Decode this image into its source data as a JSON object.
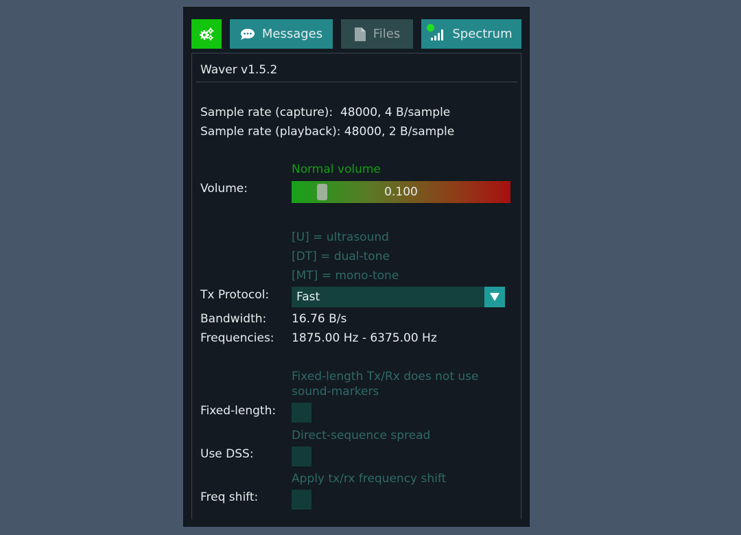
{
  "tabs": {
    "settings": {
      "icon": "gears-icon",
      "active_color": "#13c40f"
    },
    "messages": {
      "label": "Messages",
      "icon": "chat-bubble-icon"
    },
    "files": {
      "label": "Files",
      "icon": "file-icon"
    },
    "spectrum": {
      "label": "Spectrum",
      "icon": "signal-bars-icon"
    }
  },
  "panel": {
    "version": "Waver v1.5.2",
    "capture_rate": "Sample rate (capture):  48000, 4 B/sample",
    "playback_rate": "Sample rate (playback): 48000, 2 B/sample",
    "volume": {
      "status": "Normal volume",
      "label": "Volume:",
      "value": "0.100",
      "fraction": 0.1
    },
    "protocol_hints": [
      "[U] = ultrasound",
      "[DT] = dual-tone",
      "[MT] = mono-tone"
    ],
    "tx_protocol": {
      "label": "Tx Protocol:",
      "selected": "Fast"
    },
    "bandwidth": {
      "label": "Bandwidth:",
      "value": "16.76 B/s"
    },
    "frequencies": {
      "label": "Frequencies:",
      "value": "1875.00 Hz - 6375.00 Hz"
    },
    "fixed_length": {
      "hint_line1": "Fixed-length Tx/Rx does not use",
      "hint_line2": "sound-markers",
      "label": "Fixed-length:",
      "checked": false
    },
    "use_dss": {
      "hint": "Direct-sequence spread",
      "label": "Use DSS:",
      "checked": false
    },
    "freq_shift": {
      "hint": "Apply tx/rx frequency shift",
      "label": "Freq shift:",
      "checked": false
    }
  },
  "colors": {
    "background": "#475669",
    "panel": "#131a21",
    "accent": "#24888a",
    "hint_text": "#2f6a67",
    "status_green": "#129e12"
  }
}
